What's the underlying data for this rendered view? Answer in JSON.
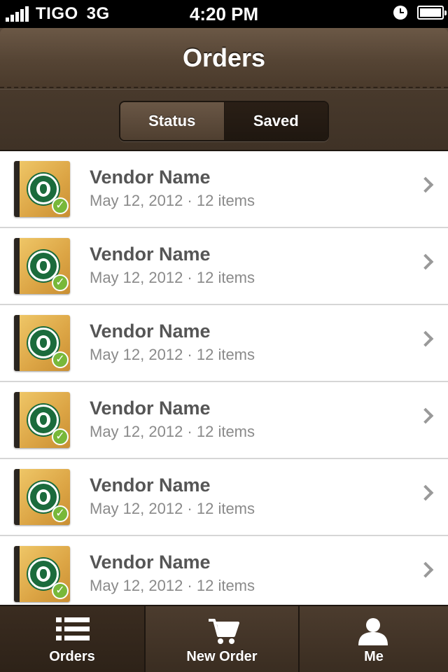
{
  "status_bar": {
    "carrier": "TIGO",
    "network": "3G",
    "time": "4:20 PM",
    "icons": [
      "signal-bars-icon",
      "clock-icon",
      "battery-icon"
    ]
  },
  "header": {
    "title": "Orders",
    "segments": [
      {
        "label": "Status",
        "selected": false
      },
      {
        "label": "Saved",
        "selected": true
      }
    ]
  },
  "orders": [
    {
      "vendor": "Vendor Name",
      "meta": "May 12, 2012 · 12 items"
    },
    {
      "vendor": "Vendor Name",
      "meta": "May 12, 2012 · 12 items"
    },
    {
      "vendor": "Vendor Name",
      "meta": "May 12, 2012 · 12 items"
    },
    {
      "vendor": "Vendor Name",
      "meta": "May 12, 2012 · 12 items"
    },
    {
      "vendor": "Vendor Name",
      "meta": "May 12, 2012 · 12 items"
    },
    {
      "vendor": "Vendor Name",
      "meta": "May 12, 2012 · 12 items"
    }
  ],
  "tabbar": {
    "tabs": [
      {
        "label": "Orders",
        "icon": "list-icon",
        "selected": true
      },
      {
        "label": "New Order",
        "icon": "cart-icon",
        "selected": false
      },
      {
        "label": "Me",
        "icon": "person-icon",
        "selected": false
      }
    ]
  },
  "colors": {
    "header_brown": "#4a3b2d",
    "selected_segment": "#1f1710",
    "check_green": "#78b83a"
  }
}
